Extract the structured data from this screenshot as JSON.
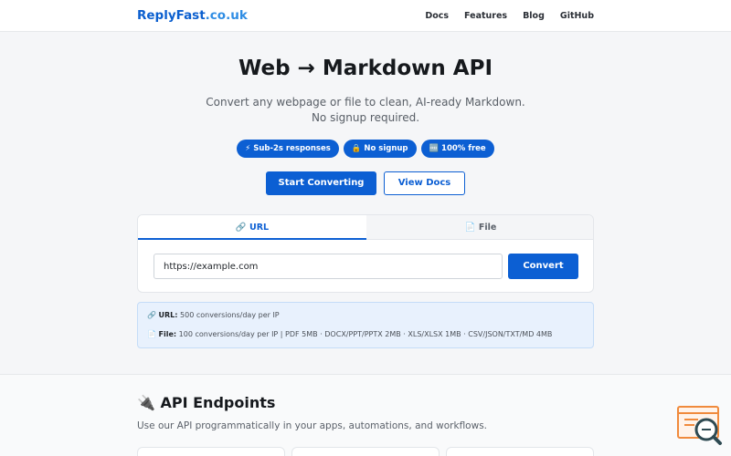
{
  "header": {
    "brand_name": "ReplyFast",
    "brand_tld": ".co.uk",
    "nav": [
      "Docs",
      "Features",
      "Blog",
      "GitHub"
    ]
  },
  "hero": {
    "title": "Web → Markdown API",
    "subtitle": "Convert any webpage or file to clean, AI-ready Markdown. No signup required.",
    "badges": [
      "⚡ Sub-2s responses",
      "🔒 No signup",
      "🆓 100% free"
    ],
    "primary_button": "Start Converting",
    "secondary_button": "View Docs"
  },
  "converter": {
    "tabs": [
      {
        "label": "🔗 URL",
        "active": true
      },
      {
        "label": "📄 File",
        "active": false
      }
    ],
    "input_value": "https://example.com",
    "input_placeholder": "https://example.com",
    "convert_button": "Convert"
  },
  "limits": {
    "url_label": "URL:",
    "url_text": "500 conversions/day per IP",
    "file_label": "File:",
    "file_text": "100 conversions/day per IP | PDF 5MB · DOCX/PPT/PPTX 2MB · XLS/XLSX 1MB · CSV/JSON/TXT/MD 4MB",
    "url_icon": "link-icon",
    "file_icon": "file-icon"
  },
  "api_section": {
    "title": "🔌 API Endpoints",
    "subtitle": "Use our API programmatically in your apps, automations, and workflows."
  },
  "colors": {
    "primary": "#0c5fd3",
    "page_bg": "#f5f6f8",
    "info_bg": "#e8f1fd",
    "helper_accent": "#f08a3c",
    "helper_dark": "#2e4a52"
  },
  "icons": {
    "helper_widget": "chat-search-icon"
  }
}
